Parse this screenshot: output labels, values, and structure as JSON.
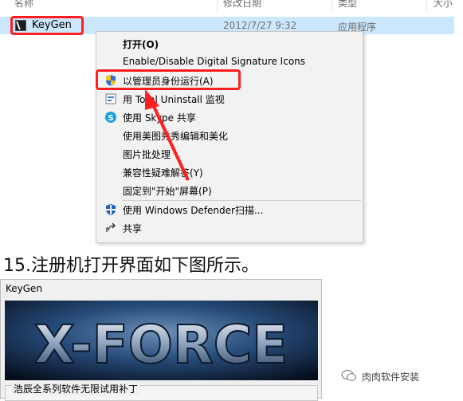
{
  "explorer": {
    "columns": [
      "名称",
      "修改日期",
      "类型",
      "大小"
    ],
    "file": {
      "name": "KeyGen",
      "date": "2012/7/27 9:32",
      "type": "应用程序"
    }
  },
  "context_menu": {
    "items": [
      {
        "label": "打开(O)",
        "icon": "",
        "bold": true
      },
      {
        "label": "Enable/Disable Digital Signature Icons",
        "icon": ""
      },
      {
        "label": "以管理员身份运行(A)",
        "icon": "uac-shield-icon"
      },
      {
        "label": "用 Total Uninstall 监视",
        "icon": "total-uninstall-icon"
      },
      {
        "label": "使用 Skype 共享",
        "icon": "skype-icon"
      },
      {
        "label": "使用美图秀秀编辑和美化",
        "icon": ""
      },
      {
        "label": "图片批处理",
        "icon": ""
      },
      {
        "label": "兼容性疑难解答(Y)",
        "icon": ""
      },
      {
        "label": "固定到\"开始\"屏幕(P)",
        "icon": ""
      },
      {
        "label": "使用 Windows Defender扫描...",
        "icon": "windows-defender-icon"
      },
      {
        "label": "共享",
        "icon": "share-icon"
      }
    ]
  },
  "step": {
    "title": "15.注册机打开界面如下图所示。"
  },
  "keygen": {
    "window_title": "KeyGen",
    "banner_text": "X-FORCE",
    "patch_label": "浩辰全系列软件无限试用补丁"
  },
  "watermark": {
    "text": "肉肉软件安装"
  },
  "colors": {
    "highlight": "#ff1f1f",
    "selection": "#cce8ff",
    "menu_bg": "#f2f2f2"
  }
}
